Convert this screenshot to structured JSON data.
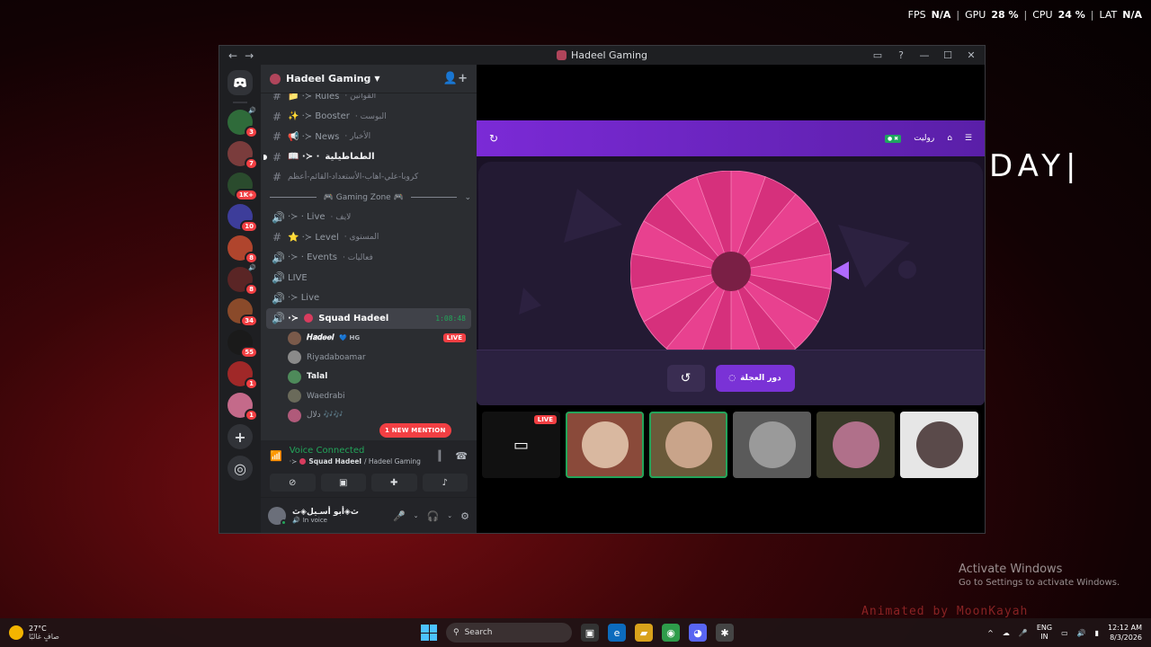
{
  "perf": {
    "fps_label": "FPS",
    "fps": "N/A",
    "gpu_label": "GPU",
    "gpu": "28 %",
    "cpu_label": "CPU",
    "cpu": "24 %",
    "lat_label": "LAT",
    "lat": "N/A"
  },
  "wallpaper": {
    "text": "DAY|",
    "activate_title": "Activate Windows",
    "activate_sub": "Go to Settings to activate Windows.",
    "watermark": "Animated by MoonKayah"
  },
  "window": {
    "title": "Hadeel Gaming",
    "back": "←",
    "forward": "→"
  },
  "servers": {
    "badges": [
      "3",
      "7",
      "1K+",
      "10",
      "8",
      "8",
      "34",
      "55",
      "1",
      "1"
    ]
  },
  "guild": {
    "name": "Hadeel Gaming"
  },
  "channels": [
    {
      "prefix": "📁 ·≻ Rules",
      "ar": "· القوانين"
    },
    {
      "prefix": "✨ ·≻ Booster",
      "ar": "· البوست"
    },
    {
      "prefix": "📢 ·≻ News",
      "ar": "· الأخبار"
    },
    {
      "prefix": "📖 ·≻ ·",
      "ar": "الطماطيلية"
    },
    {
      "prefix": "",
      "ar": "كروبا-علي-اهاب-الأستعداد-القائم-أعظم"
    }
  ],
  "category": {
    "label": "🎮 Gaming Zone 🎮"
  },
  "channels2": [
    {
      "prefix": "·≻ · Live",
      "ar": "· لايف",
      "icon": "🔊"
    },
    {
      "prefix": "⭐ ·≻ Level",
      "ar": "· المستوى",
      "icon": "#"
    },
    {
      "prefix": "·≻ · Events",
      "ar": "· فعاليات",
      "icon": "🔊"
    },
    {
      "prefix": "LIVE",
      "ar": "",
      "icon": "🔊"
    },
    {
      "prefix": "·≻ Live",
      "ar": "",
      "icon": "🔊"
    }
  ],
  "active_channel": {
    "name": "Squad Hadeel",
    "timer": "1:08:48"
  },
  "voice_users": [
    {
      "name": "𝑯𝒂𝒅𝒆𝒆𝒍",
      "tag": "💙 HG",
      "live": "LIVE"
    },
    {
      "name": "Riyadaboamar"
    },
    {
      "name": "Talal"
    },
    {
      "name": "Waedrabi"
    },
    {
      "name": "دلال 🎶🎶"
    }
  ],
  "mention_pill": "1 NEW MENTION",
  "voice_panel": {
    "title": "Voice Connected",
    "channel": "Squad Hadeel",
    "server": "/ Hadeel Gaming"
  },
  "user_panel": {
    "name": "ﭢ◈أبو أسـيل◈ﭢ",
    "status": "In voice"
  },
  "activity": {
    "header_right": "روليت",
    "spin_label": "دور العجلة"
  },
  "wheel": {
    "segments": 18,
    "colors": [
      "#e8418f",
      "#d6307c"
    ]
  },
  "tiles": {
    "live_label": "LIVE"
  },
  "taskbar": {
    "temp": "27°C",
    "weather": "صافٍ غالبًا",
    "search": "Search",
    "lang1": "ENG",
    "lang2": "IN",
    "time": "12:12 AM",
    "date": "8/3/2026"
  }
}
